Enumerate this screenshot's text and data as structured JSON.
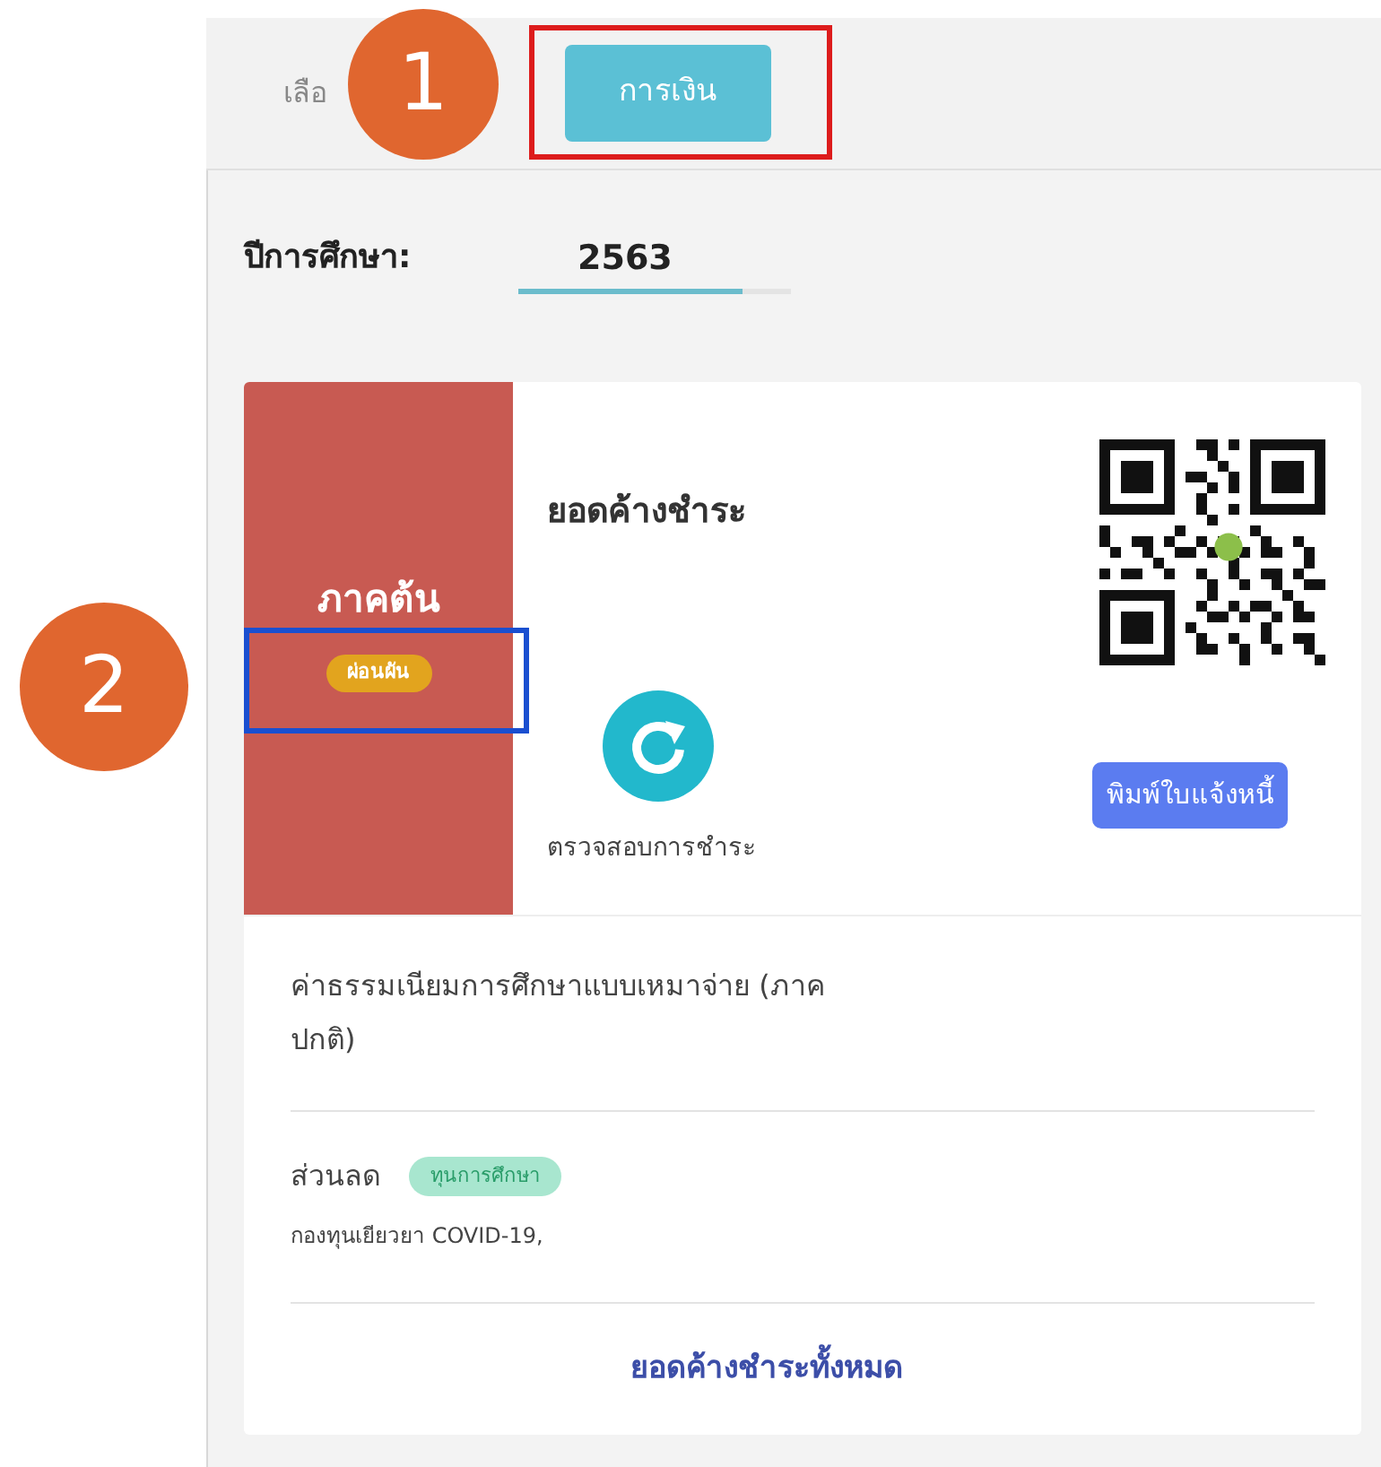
{
  "tabs": [
    {
      "label": "เลือ",
      "selected": false
    },
    {
      "label": "การเงิน",
      "selected": true
    }
  ],
  "annotations": [
    {
      "label": "1",
      "color": "#dd1c1c"
    },
    {
      "label": "2",
      "color": "#1a4fd0"
    }
  ],
  "year_label": "ปีการศึกษา:",
  "year_tabs": [
    {
      "label": "2563",
      "selected": true
    }
  ],
  "term_card": {
    "term": "ภาคต้น",
    "status_badge": "ผ่อนผัน",
    "title": "ยอดค้างชำระ",
    "check_payment_label": "ตรวจสอบการชำระ",
    "print_button": "พิมพ์ใบแจ้งหนี้"
  },
  "items": [
    {
      "kind": "fee",
      "label": "ค่าธรรมเนียมการศึกษาแบบเหมาจ่าย (ภาคปกติ)"
    },
    {
      "kind": "discount",
      "label": "ส่วนลด",
      "tag": "ทุนการศึกษา",
      "note": "กองทุนเยียวยา COVID-19,"
    }
  ],
  "total_label": "ยอดค้างชำระทั้งหมด"
}
